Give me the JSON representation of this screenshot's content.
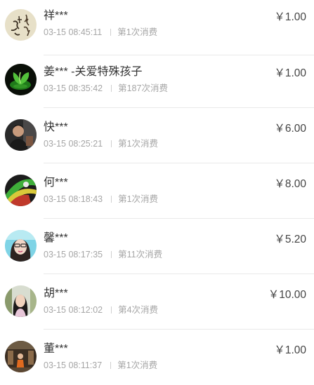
{
  "records": [
    {
      "name": "祥***",
      "time": "03-15 08:45:11",
      "count": "第1次消费",
      "amount": "￥1.00"
    },
    {
      "name": "姜*** -关爱特殊孩子",
      "time": "03-15 08:35:42",
      "count": "第187次消费",
      "amount": "￥1.00"
    },
    {
      "name": "快***",
      "time": "03-15 08:25:21",
      "count": "第1次消费",
      "amount": "￥6.00"
    },
    {
      "name": "何***",
      "time": "03-15 08:18:43",
      "count": "第1次消费",
      "amount": "￥8.00"
    },
    {
      "name": "馨***",
      "time": "03-15 08:17:35",
      "count": "第11次消费",
      "amount": "￥5.20"
    },
    {
      "name": "胡***",
      "time": "03-15 08:12:02",
      "count": "第4次消费",
      "amount": "￥10.00"
    },
    {
      "name": "董***",
      "time": "03-15 08:11:37",
      "count": "第1次消费",
      "amount": "￥1.00"
    }
  ]
}
